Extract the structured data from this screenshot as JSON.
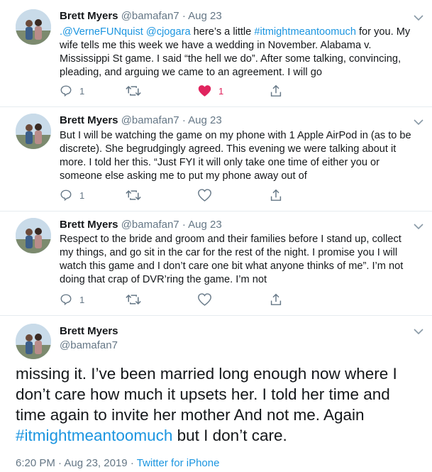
{
  "tweets": [
    {
      "name": "Brett Myers",
      "handle": "@bamafan7",
      "sep": "·",
      "date": "Aug 23",
      "mention1": ".@VerneFUNquist",
      "mention2": "@cjogara",
      "text1": " here’s a little ",
      "hashtag": "#itmightmeantoomuch",
      "text2": " for you. My wife tells me this week we have a wedding in November. Alabama v. Mississippi St game. I said “the hell we do”.  After some talking, convincing, pleading, and arguing we came to an agreement. I will go",
      "reply_count": "1",
      "retweet_count": "",
      "like_count": "1",
      "liked": true
    },
    {
      "name": "Brett Myers",
      "handle": "@bamafan7",
      "sep": "·",
      "date": "Aug 23",
      "text": "But I will be watching the game on my phone with 1 Apple AirPod in (as to be discrete). She begrudgingly agreed. This evening we were talking about it more. I told her this. “Just FYI it will only take one time of either you or someone else asking me to put my phone away out of",
      "reply_count": "1",
      "retweet_count": "",
      "like_count": "",
      "liked": false
    },
    {
      "name": "Brett Myers",
      "handle": "@bamafan7",
      "sep": "·",
      "date": "Aug 23",
      "text": "Respect to the bride and groom and their families before I stand up, collect my things, and go sit in the car for the rest of the night. I promise you I will watch this game and I don’t care one bit what anyone thinks of me”. I’m not doing that crap of DVR’ring the game. I’m not",
      "reply_count": "1",
      "retweet_count": "",
      "like_count": "",
      "liked": false
    }
  ],
  "main_tweet": {
    "name": "Brett Myers",
    "handle": "@bamafan7",
    "text1": "missing it. I’ve been married long enough now where I don’t care how much it upsets her. I told her time and time again to invite her mother And not me. Again ",
    "hashtag": "#itmightmeantoomuch",
    "text2": " but I don’t care.",
    "time": "6:20 PM",
    "sep": "·",
    "date": "Aug 23, 2019",
    "sep2": "·",
    "source": "Twitter for iPhone"
  },
  "colors": {
    "link": "#1b95e0",
    "secondary": "#657786",
    "like": "#e0245e",
    "divider": "#e6ecf0"
  },
  "icons": [
    "avatar",
    "chevron-down-icon",
    "reply-icon",
    "retweet-icon",
    "heart-icon",
    "share-icon"
  ]
}
